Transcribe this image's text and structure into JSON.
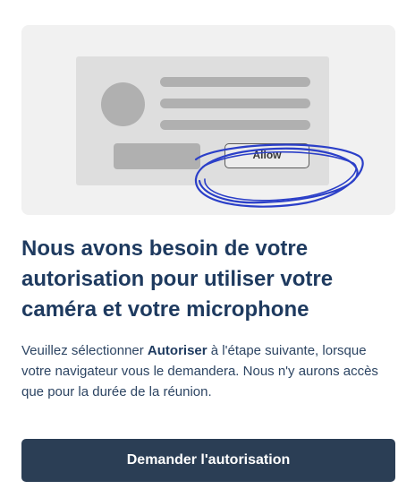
{
  "illustration": {
    "allow_label": "Allow",
    "colors": {
      "panel_bg": "#f1f1f1",
      "window_bg": "#dedede",
      "placeholder": "#b0b0b0",
      "scribble": "#2b3fc8"
    }
  },
  "title": "Nous avons besoin de votre autorisation pour utiliser votre caméra et votre microphone",
  "description": {
    "before": "Veuillez sélectionner ",
    "bold": "Autoriser",
    "after": " à l'étape suivante, lorsque votre navigateur vous le demandera. Nous n'y aurons accès que pour la durée de la réunion."
  },
  "button": {
    "label": "Demander l'autorisation",
    "color": "#2b3e55"
  }
}
